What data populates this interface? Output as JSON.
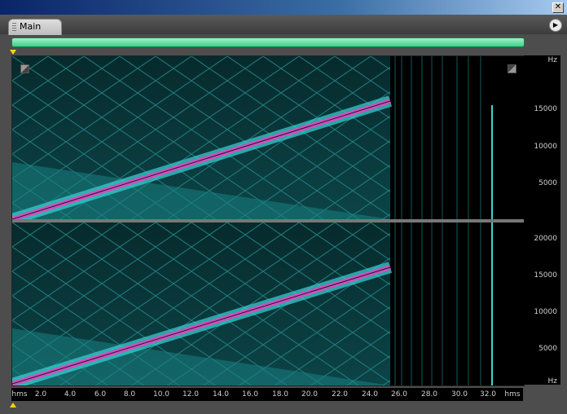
{
  "window": {
    "close_glyph": "✕"
  },
  "tab": {
    "label": "Main"
  },
  "menu": {
    "icon": "play-arrow-icon",
    "glyph": "▶"
  },
  "progress": {
    "fraction": 1.0,
    "color": "#3ed08a"
  },
  "colors": {
    "spectrum_cyan": "#39d5d5",
    "sweep_magenta": "#d04fc0",
    "background": "#000000"
  },
  "freq_axis": {
    "top_channel": [
      "Hz",
      "15000",
      "10000",
      "5000"
    ],
    "bottom_channel": [
      "20000",
      "15000",
      "10000",
      "5000",
      "Hz"
    ]
  },
  "time_axis": {
    "unit_left": "hms",
    "unit_right": "hms",
    "ticks": [
      "2.0",
      "4.0",
      "6.0",
      "8.0",
      "10.0",
      "12.0",
      "14.0",
      "16.0",
      "18.0",
      "20.0",
      "22.0",
      "24.0",
      "26.0",
      "28.0",
      "30.0",
      "32.0"
    ]
  }
}
